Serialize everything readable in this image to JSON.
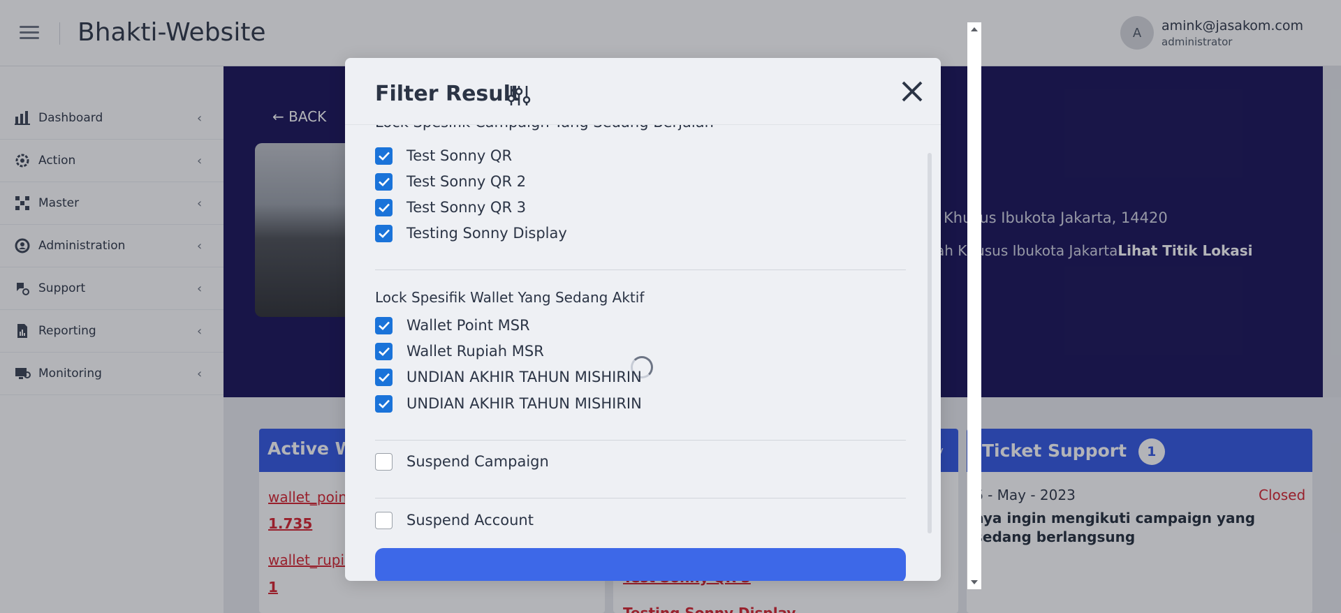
{
  "header": {
    "app_title": "Bhakti-Website",
    "user_initial": "A",
    "user_email": "amink@jasakom.com",
    "user_role": "administrator"
  },
  "sidebar": {
    "items": [
      {
        "label": "Dashboard",
        "icon": "dashboard-icon"
      },
      {
        "label": "Action",
        "icon": "gear-icon"
      },
      {
        "label": "Master",
        "icon": "grid-icon"
      },
      {
        "label": "Administration",
        "icon": "admin-gear-icon"
      },
      {
        "label": "Support",
        "icon": "support-icon"
      },
      {
        "label": "Reporting",
        "icon": "report-icon"
      },
      {
        "label": "Monitoring",
        "icon": "monitor-icon"
      }
    ]
  },
  "main": {
    "back_label": "BACK",
    "address_line1": "Khusus Ibukota Jakarta, 14420",
    "address_line2_prefix": "ah Khusus Ibukota Jakarta",
    "address_line2_link": "Lihat Titik Lokasi",
    "active_wallet_title": "Active W",
    "wallet_point_link": "wallet_poin",
    "wallet_point_value": "1.735",
    "wallet_rupiah_link": "wallet_rupia",
    "wallet_rupiah_value": "1",
    "middle_card_edge_text": "ty",
    "campaign_item_partial": "Test Sonny QR 3",
    "campaign_item_partial2": "Testing Sonny Display",
    "ticket_title": "Ticket Support",
    "ticket_count": "1",
    "ticket_date": "6 - May - 2023",
    "ticket_status": "Closed",
    "ticket_message": "aya ingin mengikuti campaign yang sedang berlangsung"
  },
  "modal": {
    "title": "Filter Result",
    "campaign_section_title": "Lock Spesifik Campaign Yang Sedang Berjalan",
    "campaigns": [
      {
        "label": "Test Sonny QR",
        "checked": true
      },
      {
        "label": "Test Sonny QR 2",
        "checked": true
      },
      {
        "label": "Test Sonny QR 3",
        "checked": true
      },
      {
        "label": "Testing Sonny Display",
        "checked": true
      }
    ],
    "wallet_section_title": "Lock Spesifik Wallet Yang Sedang Aktif",
    "wallets": [
      {
        "label": "Wallet Point MSR",
        "checked": true
      },
      {
        "label": "Wallet Rupiah MSR",
        "checked": true
      },
      {
        "label": "UNDIAN AKHIR TAHUN MISHIRIN",
        "checked": true
      },
      {
        "label": "UNDIAN AKHIR TAHUN MISHIRIN",
        "checked": true
      }
    ],
    "suspend_campaign_label": "Suspend Campaign",
    "suspend_campaign_checked": false,
    "suspend_account_label": "Suspend Account",
    "suspend_account_checked": false
  },
  "colors": {
    "accent": "#2f55e3",
    "hero_bg": "#150f56",
    "checkbox": "#1a73d9",
    "danger": "#d61f2b"
  }
}
